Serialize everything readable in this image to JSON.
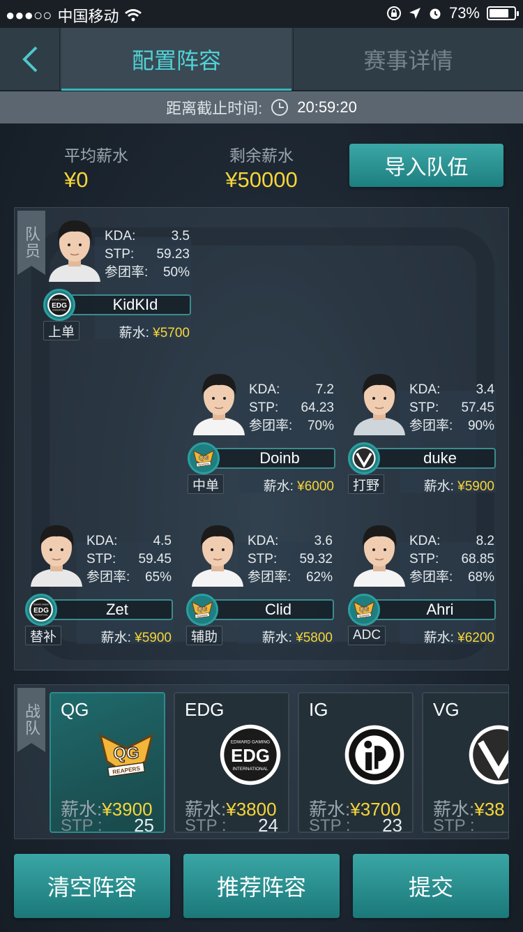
{
  "status_bar": {
    "signal": "●●●○○",
    "carrier": "中国移动",
    "battery": "73%"
  },
  "nav": {
    "tabs": [
      {
        "label": "配置阵容"
      },
      {
        "label": "赛事详情"
      }
    ]
  },
  "deadline": {
    "label": "距离截止时间:",
    "time": "20:59:20"
  },
  "summary": {
    "avg_salary_label": "平均薪水",
    "avg_salary": "¥0",
    "remaining_label": "剩余薪水",
    "remaining": "¥50000",
    "import_button": "导入队伍"
  },
  "roster": {
    "tag": "队员",
    "salary_label": "薪水:",
    "stat_labels": {
      "kda": "KDA:",
      "stp": "STP:",
      "rate": "参团率:"
    },
    "players": [
      {
        "name": "KidKId",
        "team": "EDG",
        "position": "上单",
        "kda": "3.5",
        "stp": "59.23",
        "rate": "50%",
        "salary": "¥5700"
      },
      {
        "name": "Doinb",
        "team": "QG",
        "position": "中单",
        "kda": "7.2",
        "stp": "64.23",
        "rate": "70%",
        "salary": "¥6000"
      },
      {
        "name": "duke",
        "team": "VG",
        "position": "打野",
        "kda": "3.4",
        "stp": "57.45",
        "rate": "90%",
        "salary": "¥5900"
      },
      {
        "name": "Zet",
        "team": "EDG",
        "position": "替补",
        "kda": "4.5",
        "stp": "59.45",
        "rate": "65%",
        "salary": "¥5900"
      },
      {
        "name": "Clid",
        "team": "QG",
        "position": "辅助",
        "kda": "3.6",
        "stp": "59.32",
        "rate": "62%",
        "salary": "¥5800"
      },
      {
        "name": "Ahri",
        "team": "QG",
        "position": "ADC",
        "kda": "8.2",
        "stp": "68.85",
        "rate": "68%",
        "salary": "¥6200"
      }
    ]
  },
  "teams": {
    "tag": "战队",
    "salary_label": "薪水:",
    "stp_label": "STP :",
    "logo_text": {
      "qg_top": "QG",
      "qg_bottom": "REAPERS",
      "edg_top": "EDWARD GAMING",
      "edg_mid": "EDG",
      "edg_bottom": "INTERNATIONAL"
    },
    "list": [
      {
        "name": "QG",
        "salary": "¥3900",
        "stp": "25"
      },
      {
        "name": "EDG",
        "salary": "¥3800",
        "stp": "24"
      },
      {
        "name": "IG",
        "salary": "¥3700",
        "stp": "23"
      },
      {
        "name": "VG",
        "salary": "¥38",
        "stp": ""
      }
    ]
  },
  "actions": {
    "clear": "清空阵容",
    "recommend": "推荐阵容",
    "submit": "提交"
  },
  "colors": {
    "accent": "#33b8bf",
    "money": "#f7d63a",
    "button": "#1f8283"
  }
}
